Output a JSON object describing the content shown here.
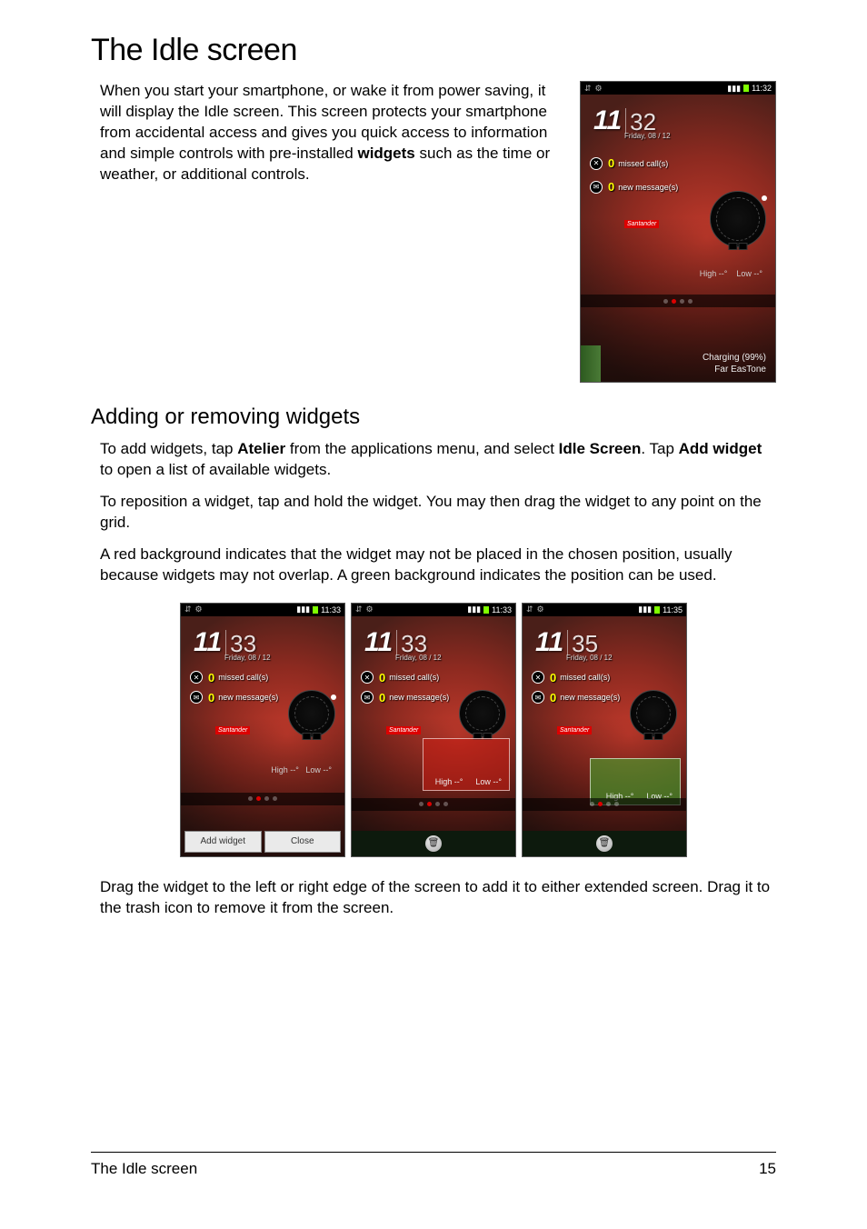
{
  "headings": {
    "h1": "The Idle screen",
    "h2": "Adding or removing widgets"
  },
  "paragraphs": {
    "intro_part1": "When you start your smartphone, or wake it from power saving, it will display the Idle screen. This screen protects your smartphone from accidental access and gives you quick access to information and simple controls with pre-installed ",
    "intro_bold": "widgets",
    "intro_part2": " such as the time or weather, or additional controls.",
    "p2a": "To add widgets, tap ",
    "p2b": "Atelier",
    "p2c": " from the applications menu, and select ",
    "p2d": "Idle Screen",
    "p2e": ". Tap ",
    "p2f": "Add widget",
    "p2g": " to open a list of available widgets.",
    "p3": "To reposition a widget, tap and hold the widget. You may then drag the widget to any point on the grid.",
    "p4": "A red background indicates that the widget may not be placed in the chosen position, usually because widgets may not overlap. A green background indicates the position can be used.",
    "p5": "Drag the widget to the left or right edge of the screen to add it to either extended screen. Drag it to the trash icon to remove it from the screen."
  },
  "footer": {
    "left": "The Idle screen",
    "page": "15"
  },
  "phone": {
    "clock_hh": "11",
    "date": "Friday, 08 / 12",
    "missed_count": "0",
    "missed_label": "missed call(s)",
    "msg_count": "0",
    "msg_label": "new message(s)",
    "santander": "Santander",
    "high": "High --°",
    "low": "Low --°",
    "signal_glyph": "▮▮▮",
    "wifi_glyph": "⇵",
    "notif_glyph": "⚙"
  },
  "big_phone": {
    "clock_mm": "32",
    "status_time": "11:32",
    "charging": "Charging (99%)",
    "carrier": "Far EasTone"
  },
  "mini": {
    "a": {
      "clock_mm": "33",
      "status_time": "11:33",
      "add_widget": "Add widget",
      "close": "Close"
    },
    "b": {
      "clock_mm": "33",
      "status_time": "11:33"
    },
    "c": {
      "clock_mm": "35",
      "status_time": "11:35"
    }
  }
}
